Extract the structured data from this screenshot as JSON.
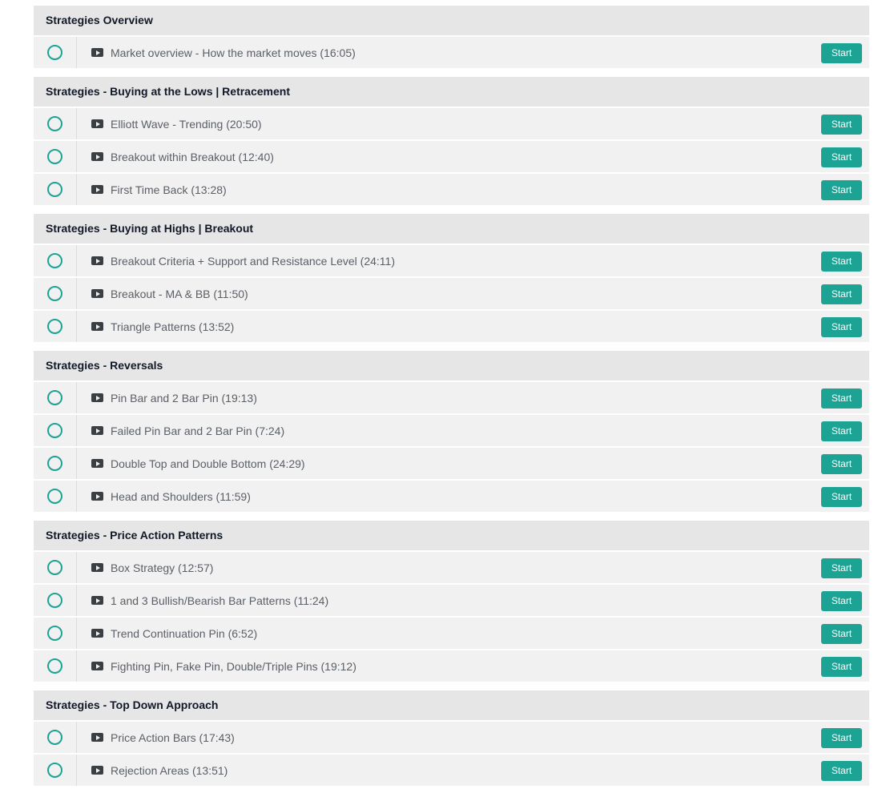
{
  "sections": [
    {
      "title": "Strategies Overview",
      "lectures": [
        {
          "name": "Market overview - How the market moves (16:05)",
          "action": "Start"
        }
      ]
    },
    {
      "title": "Strategies - Buying at the Lows | Retracement",
      "lectures": [
        {
          "name": "Elliott Wave - Trending (20:50)",
          "action": "Start"
        },
        {
          "name": "Breakout within Breakout (12:40)",
          "action": "Start"
        },
        {
          "name": "First Time Back (13:28)",
          "action": "Start"
        }
      ]
    },
    {
      "title": "Strategies - Buying at Highs | Breakout",
      "lectures": [
        {
          "name": "Breakout Criteria + Support and Resistance Level (24:11)",
          "action": "Start"
        },
        {
          "name": "Breakout - MA & BB (11:50)",
          "action": "Start"
        },
        {
          "name": "Triangle Patterns (13:52)",
          "action": "Start"
        }
      ]
    },
    {
      "title": "Strategies - Reversals",
      "lectures": [
        {
          "name": "Pin Bar and 2 Bar Pin (19:13)",
          "action": "Start"
        },
        {
          "name": "Failed Pin Bar and 2 Bar Pin (7:24)",
          "action": "Start"
        },
        {
          "name": "Double Top and Double Bottom (24:29)",
          "action": "Start"
        },
        {
          "name": "Head and Shoulders (11:59)",
          "action": "Start"
        }
      ]
    },
    {
      "title": "Strategies - Price Action Patterns",
      "lectures": [
        {
          "name": "Box Strategy (12:57)",
          "action": "Start"
        },
        {
          "name": "1 and 3 Bullish/Bearish Bar Patterns (11:24)",
          "action": "Start"
        },
        {
          "name": "Trend Continuation Pin (6:52)",
          "action": "Start"
        },
        {
          "name": "Fighting Pin, Fake Pin, Double/Triple Pins (19:12)",
          "action": "Start"
        }
      ]
    },
    {
      "title": "Strategies - Top Down Approach",
      "lectures": [
        {
          "name": "Price Action Bars (17:43)",
          "action": "Start"
        },
        {
          "name": "Rejection Areas (13:51)",
          "action": "Start"
        }
      ]
    }
  ],
  "colors": {
    "accent": "#1da394",
    "section_header_bg": "#e6e6e6",
    "row_bg": "#f1f1f1",
    "title_text": "#111827",
    "row_text": "#5a5f66"
  },
  "icons": {
    "status": "circle-outline-icon",
    "lecture_type": "video-play-icon"
  }
}
